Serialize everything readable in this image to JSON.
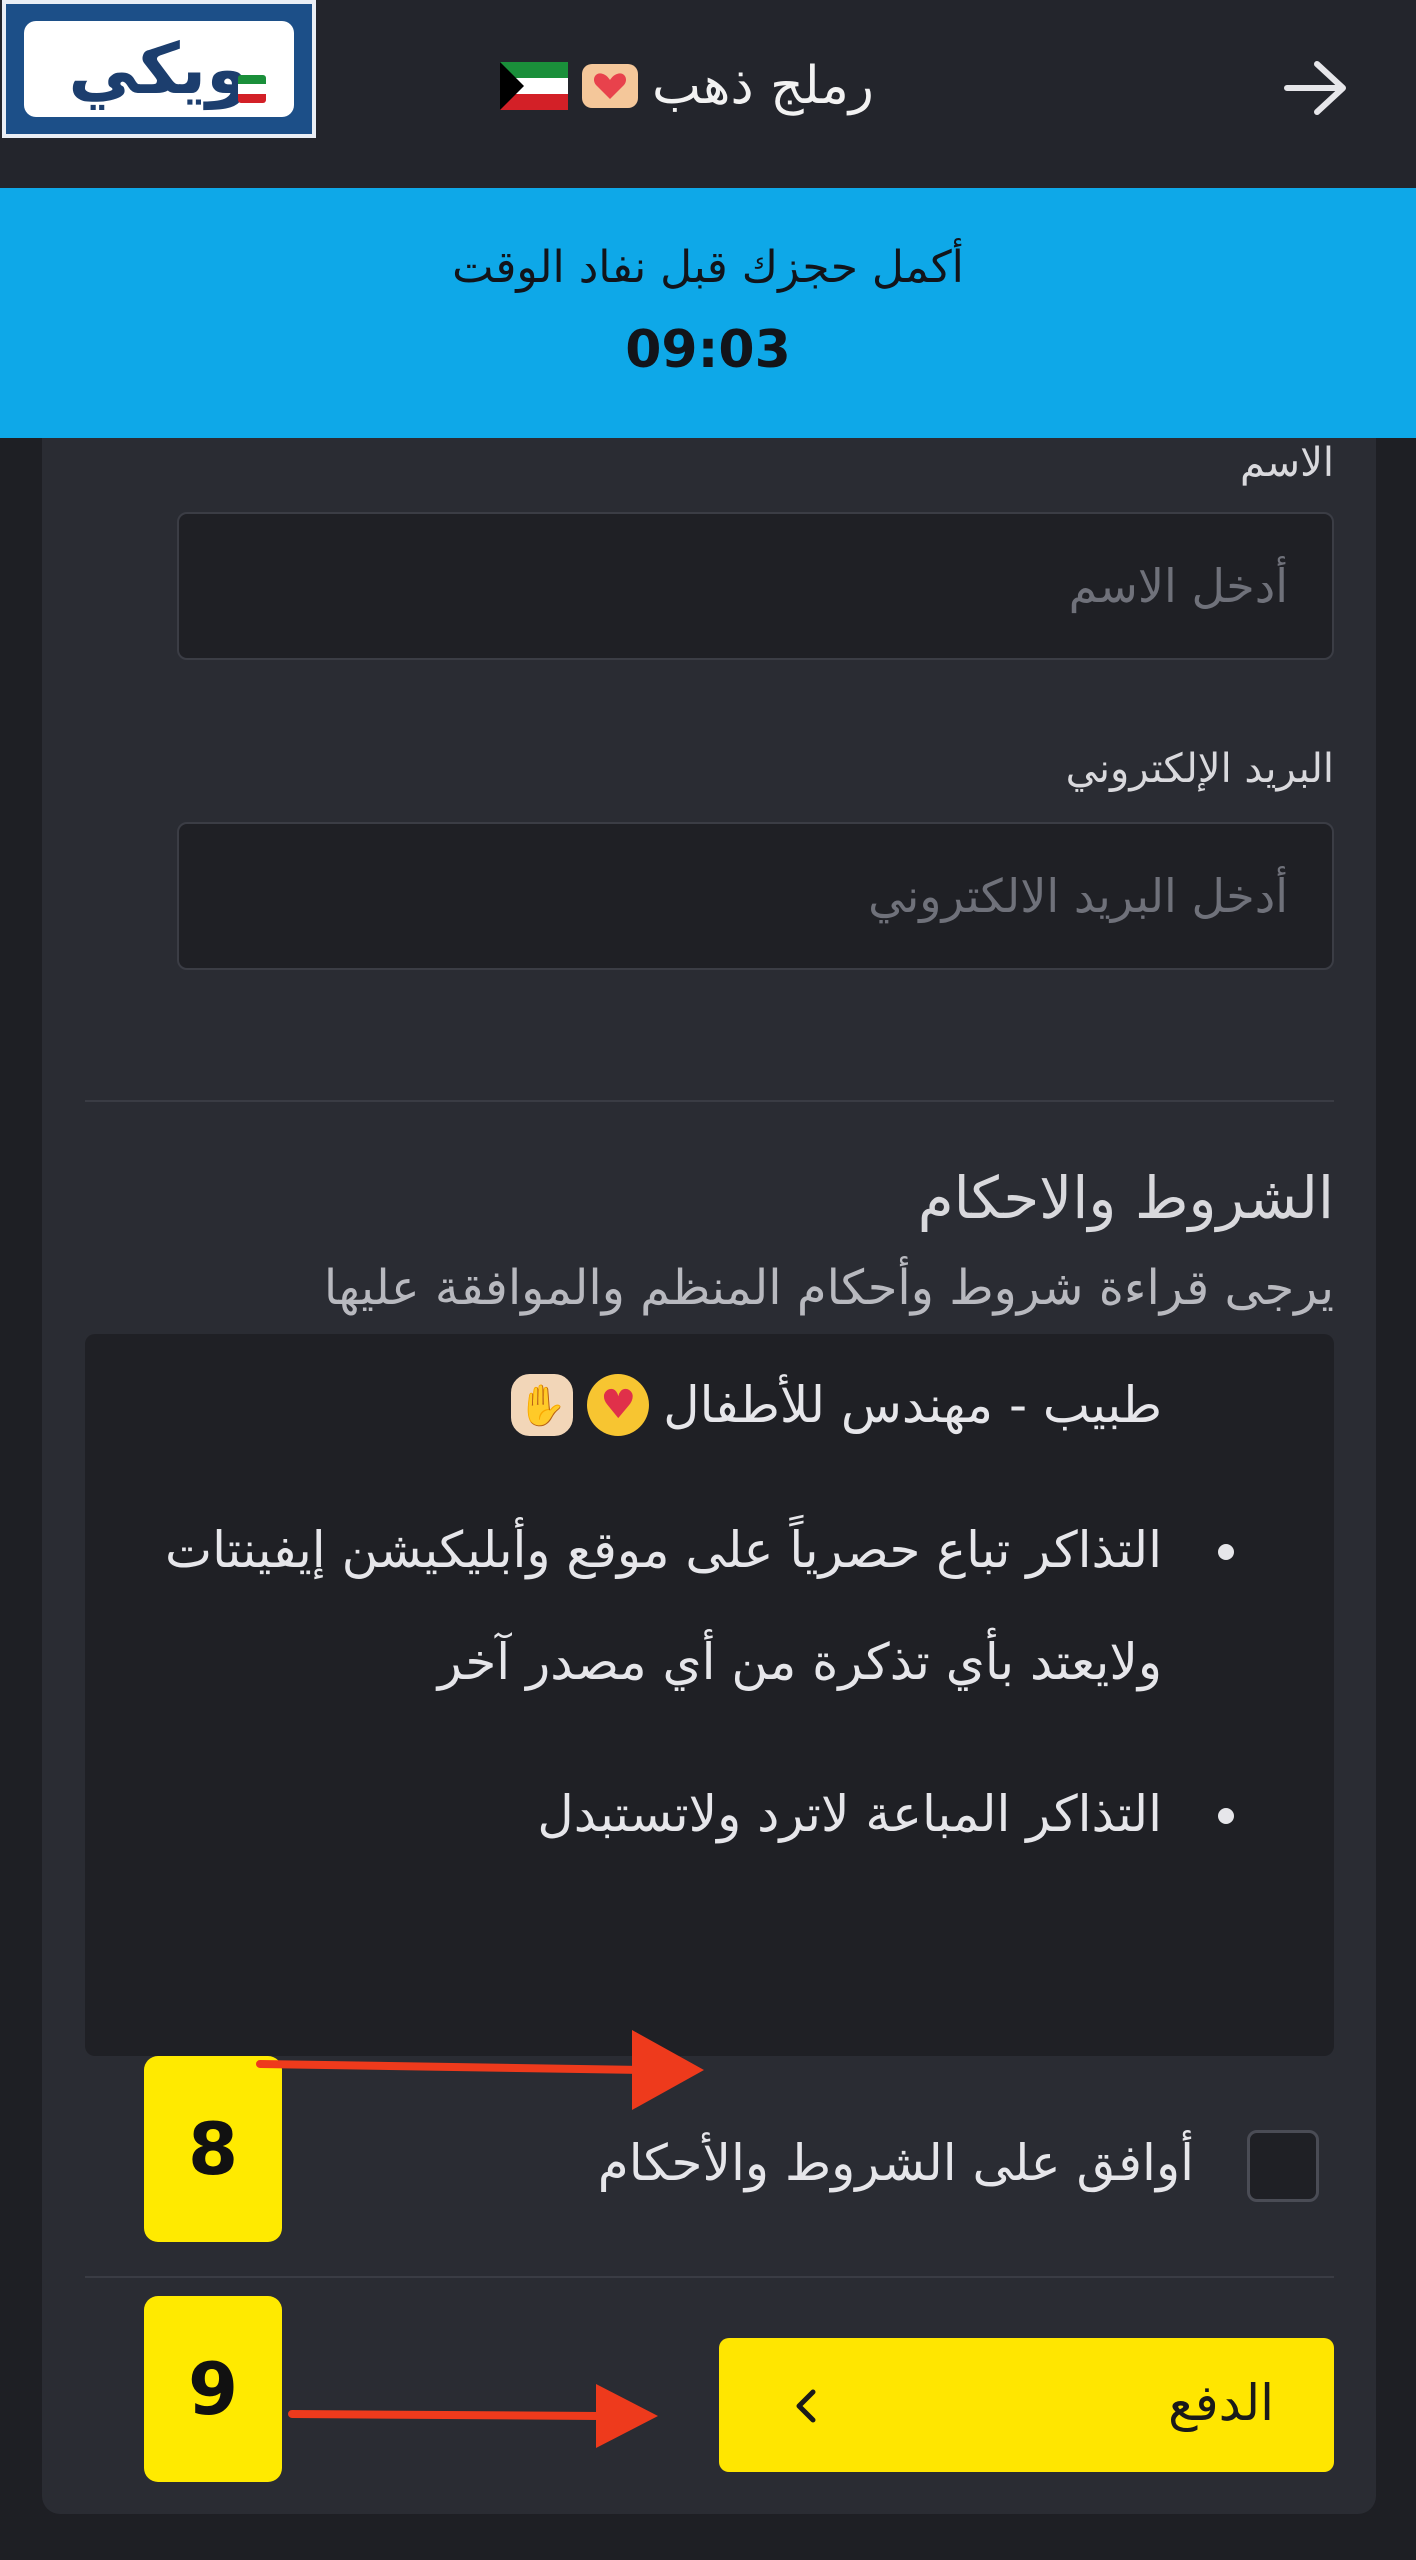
{
  "header": {
    "logo_text": "ويكي",
    "title": "رملج ذهب",
    "back_icon": "arrow-right-icon"
  },
  "timer": {
    "message": "أكمل حجزك قبل نفاد الوقت",
    "countdown": "09:03"
  },
  "form": {
    "name_label": "الاسم",
    "name_placeholder": "أدخل الاسم",
    "email_label": "البريد الإلكتروني",
    "email_placeholder": "أدخل البريد الالكتروني"
  },
  "terms": {
    "title": "الشروط والاحكام",
    "subtitle": "يرجى قراءة شروط وأحكام المنظم والموافقة عليها",
    "partial_line": "طبيب - مهندس للأطفال",
    "bullets": [
      "التذاكر تباع حصرياً على موقع وأبليكيشن إيفينتات ولايعتد بأي تذكرة من أي مصدر آخر",
      "التذاكر المباعة لاترد ولاتستبدل"
    ],
    "agree_label": "أوافق على الشروط والأحكام"
  },
  "actions": {
    "pay_label": "الدفع"
  },
  "annotations": {
    "step_8": "8",
    "step_9": "9"
  },
  "colors": {
    "banner": "#0ea8e8",
    "accent": "#ffe600",
    "arrow": "#ee3a1c"
  }
}
